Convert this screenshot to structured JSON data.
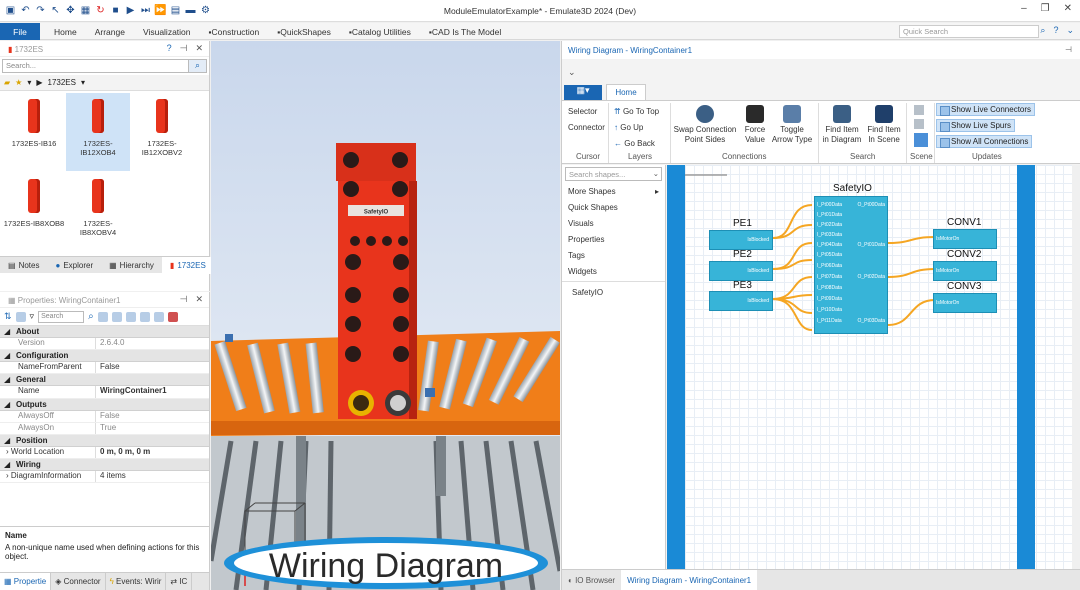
{
  "app": {
    "title": "ModuleEmulatorExample* - Emulate3D 2024 (Dev)"
  },
  "menu": {
    "file": "File",
    "items": [
      "Home",
      "Arrange",
      "Visualization",
      "▪Construction",
      "▪QuickShapes",
      "▪Catalog Utilities",
      "▪CAD Is The Model"
    ],
    "quick_search_placeholder": "Quick Search"
  },
  "catalog": {
    "title": "1732ES",
    "search_placeholder": "Search...",
    "breadcrumb": "1732ES",
    "items": [
      "1732ES-IB16",
      "1732ES-IB12XOB4",
      "1732ES-IB12XOBV2",
      "1732ES-IB8XOB8",
      "1732ES-IB8XOBV4"
    ],
    "tabs": [
      "Notes",
      "Explorer",
      "Hierarchy",
      "1732ES"
    ]
  },
  "properties": {
    "title": "Properties: WiringContainer1",
    "search_placeholder": "Search",
    "sections": [
      {
        "name": "About",
        "rows": [
          {
            "k": "Version",
            "v": "2.6.4.0"
          }
        ]
      },
      {
        "name": "Configuration",
        "rows": [
          {
            "k": "NameFromParent",
            "v": "False"
          }
        ]
      },
      {
        "name": "General",
        "rows": [
          {
            "k": "Name",
            "v": "WiringContainer1"
          }
        ]
      },
      {
        "name": "Outputs",
        "rows": [
          {
            "k": "AlwaysOff",
            "v": "False"
          },
          {
            "k": "AlwaysOn",
            "v": "True"
          }
        ]
      },
      {
        "name": "Position",
        "rows": [
          {
            "k": "World Location",
            "v": "0 m, 0 m, 0 m"
          }
        ]
      },
      {
        "name": "Wiring",
        "rows": [
          {
            "k": "DiagramInformation",
            "v": "4 items"
          }
        ]
      }
    ],
    "desc_title": "Name",
    "desc_text": "A non-unique name used when defining actions for this object.",
    "tabs": [
      "Propertie",
      "Connector",
      "Events: Wirir",
      "IC"
    ]
  },
  "scene": {
    "module_label": "SafetyIO",
    "banner": "Wiring Diagram"
  },
  "wiring": {
    "title": "Wiring Diagram - WiringContainer1",
    "home_tab": "Home",
    "ribbon": {
      "selector": "Selector",
      "connector": "Connector",
      "cursor": "Cursor",
      "go_top": "Go To Top",
      "go_up": "Go Up",
      "go_back": "Go Back",
      "layers": "Layers",
      "swap1": "Swap Connection",
      "swap2": "Point Sides",
      "force1": "Force",
      "force2": "Value",
      "toggle1": "Toggle",
      "toggle2": "Arrow Type",
      "connections": "Connections",
      "find1a": "Find Item",
      "find1b": "in Diagram",
      "find2a": "Find Item",
      "find2b": "In Scene",
      "search": "Search",
      "scene": "Scene",
      "live_conn": "Show Live Connectors",
      "live_spurs": "Show Live Spurs",
      "all_conn": "Show All Connections",
      "updates": "Updates"
    },
    "shapes": {
      "search_placeholder": "Search shapes...",
      "items": [
        "More Shapes",
        "Quick Shapes",
        "Visuals",
        "Properties",
        "Tags",
        "Widgets",
        "SafetyIO"
      ]
    },
    "diagram": {
      "pe": [
        "PE1",
        "PE2",
        "PE3"
      ],
      "pe_port": "IsBlocked",
      "safety": "SafetyIO",
      "conv": [
        "CONV1",
        "CONV2",
        "CONV3"
      ],
      "conv_port": "IsMotorOn",
      "inputs": [
        "I_Pt00Data",
        "I_Pt01Data",
        "I_Pt02Data",
        "I_Pt03Data",
        "I_Pt04Data",
        "I_Pt05Data",
        "I_Pt06Data",
        "I_Pt07Data",
        "I_Pt08Data",
        "I_Pt09Data",
        "I_Pt10Data",
        "I_Pt11Data"
      ],
      "outputs": [
        "O_Pt00Data",
        "O_Pt01Data",
        "O_Pt02Data",
        "O_Pt03Data"
      ]
    },
    "bottom_tabs": [
      "IO Browser",
      "Wiring Diagram - WiringContainer1"
    ]
  },
  "colors": {
    "accent": "#1a66b3",
    "module": "#e8341c",
    "box": "#37b4d8",
    "wire": "#f5a623"
  }
}
